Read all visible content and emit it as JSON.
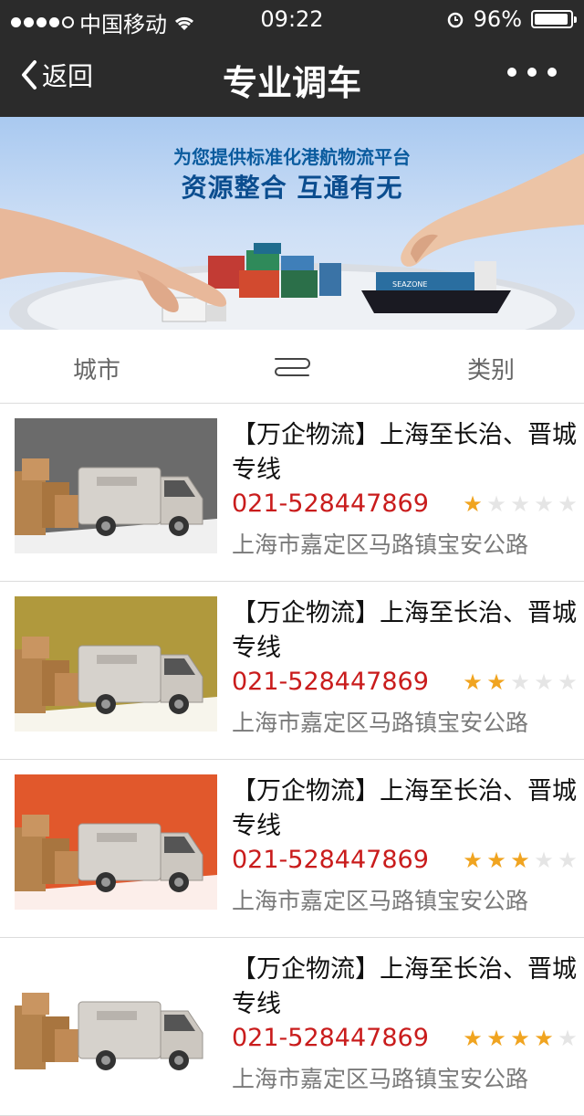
{
  "status_bar": {
    "carrier": "中国移动",
    "time": "09:22",
    "battery": "96%",
    "battery_level": 0.96
  },
  "nav": {
    "back_label": "返回",
    "title": "专业调车"
  },
  "banner": {
    "line1": "为您提供标准化港航物流平台",
    "line2": "资源整合 互通有无",
    "ship_text": "SEAZONE"
  },
  "filter": {
    "city_label": "城市",
    "category_label": "类别"
  },
  "listings": [
    {
      "name": "【万企物流】上海至长治、晋城专线",
      "phone": "021-528447869",
      "address": "上海市嘉定区马路镇宝安公路",
      "rating": 1,
      "bg": "#6b6b6b"
    },
    {
      "name": "【万企物流】上海至长治、晋城专线",
      "phone": "021-528447869",
      "address": "上海市嘉定区马路镇宝安公路",
      "rating": 2,
      "bg": "#b0993d"
    },
    {
      "name": "【万企物流】上海至长治、晋城专线",
      "phone": "021-528447869",
      "address": "上海市嘉定区马路镇宝安公路",
      "rating": 3,
      "bg": "#e1582c"
    },
    {
      "name": "【万企物流】上海至长治、晋城专线",
      "phone": "021-528447869",
      "address": "上海市嘉定区马路镇宝安公路",
      "rating": 4,
      "bg": "#ffffff"
    }
  ],
  "colors": {
    "header_bg": "#2b2b2b",
    "phone_red": "#c91c1c",
    "star_on": "#f0a420",
    "star_off": "#e5e5e5"
  }
}
